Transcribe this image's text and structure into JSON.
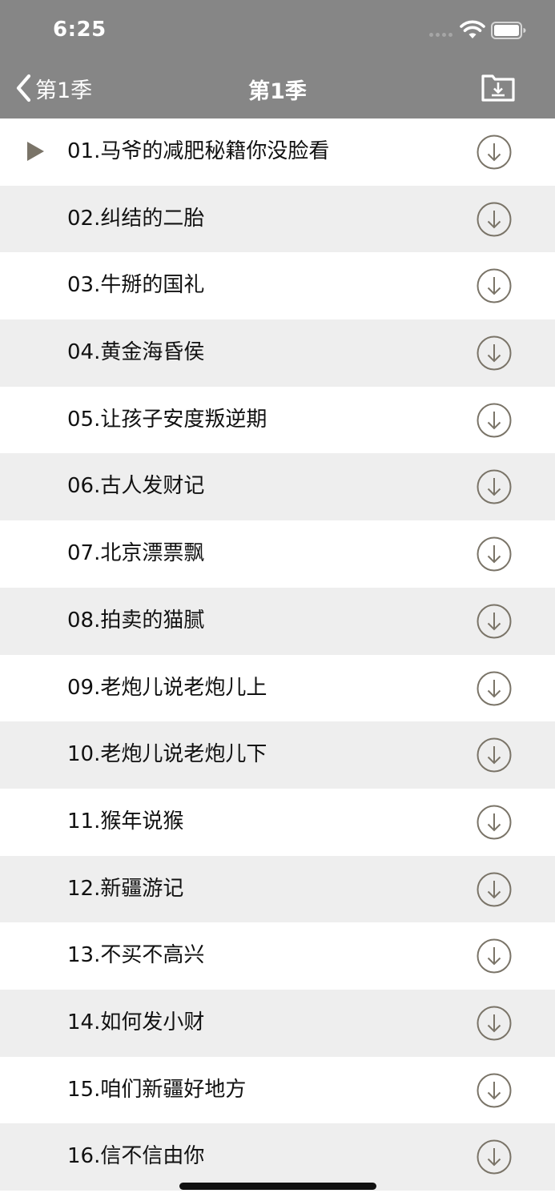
{
  "status_bar": {
    "time": "6:25"
  },
  "nav": {
    "back_label": "第1季",
    "title": "第1季"
  },
  "episodes": [
    {
      "title": "01.马爷的减肥秘籍你没脸看",
      "playing": true
    },
    {
      "title": "02.纠结的二胎",
      "playing": false
    },
    {
      "title": "03.牛掰的国礼",
      "playing": false
    },
    {
      "title": "04.黄金海昏侯",
      "playing": false
    },
    {
      "title": "05.让孩子安度叛逆期",
      "playing": false
    },
    {
      "title": "06.古人发财记",
      "playing": false
    },
    {
      "title": "07.北京漂票飘",
      "playing": false
    },
    {
      "title": "08.拍卖的猫腻",
      "playing": false
    },
    {
      "title": "09.老炮儿说老炮儿上",
      "playing": false
    },
    {
      "title": "10.老炮儿说老炮儿下",
      "playing": false
    },
    {
      "title": "11.猴年说猴",
      "playing": false
    },
    {
      "title": "12.新疆游记",
      "playing": false
    },
    {
      "title": "13.不买不高兴",
      "playing": false
    },
    {
      "title": "14.如何发小财",
      "playing": false
    },
    {
      "title": "15.咱们新疆好地方",
      "playing": false
    },
    {
      "title": "16.信不信由你",
      "playing": false
    }
  ],
  "colors": {
    "nav_background": "#868686",
    "row_alt_background": "#eeeeee",
    "icon_color": "#7a7468"
  }
}
